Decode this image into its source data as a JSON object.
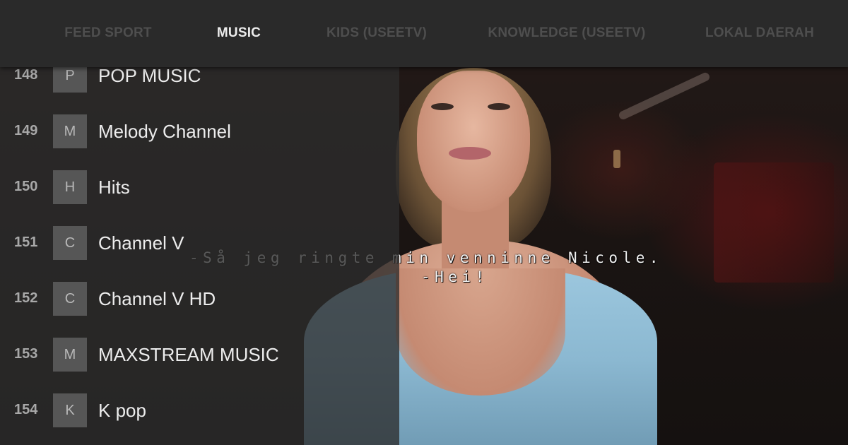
{
  "tabs": [
    {
      "label": "FEED SPORT",
      "active": false
    },
    {
      "label": "MUSIC",
      "active": true
    },
    {
      "label": "KIDS (USEETV)",
      "active": false
    },
    {
      "label": "KNOWLEDGE (USEETV)",
      "active": false
    },
    {
      "label": "LOKAL DAERAH",
      "active": false
    }
  ],
  "channels": [
    {
      "number": "148",
      "letter": "P",
      "name": "POP MUSIC"
    },
    {
      "number": "149",
      "letter": "M",
      "name": "Melody Channel"
    },
    {
      "number": "150",
      "letter": "H",
      "name": "Hits"
    },
    {
      "number": "151",
      "letter": "C",
      "name": "Channel V"
    },
    {
      "number": "152",
      "letter": "C",
      "name": "Channel V HD"
    },
    {
      "number": "153",
      "letter": "M",
      "name": "MAXSTREAM MUSIC"
    },
    {
      "number": "154",
      "letter": "K",
      "name": "K pop"
    }
  ],
  "subtitles": {
    "line1": "-Så jeg ringte min venninne Nicole.",
    "line2": "-Hei!"
  },
  "colors": {
    "tabbar_bg": "#2a2a2a",
    "tab_active": "#ececec",
    "tab_inactive": "#4e4e4e",
    "list_panel_bg": "#2d2d2d",
    "badge_bg": "#565656"
  }
}
